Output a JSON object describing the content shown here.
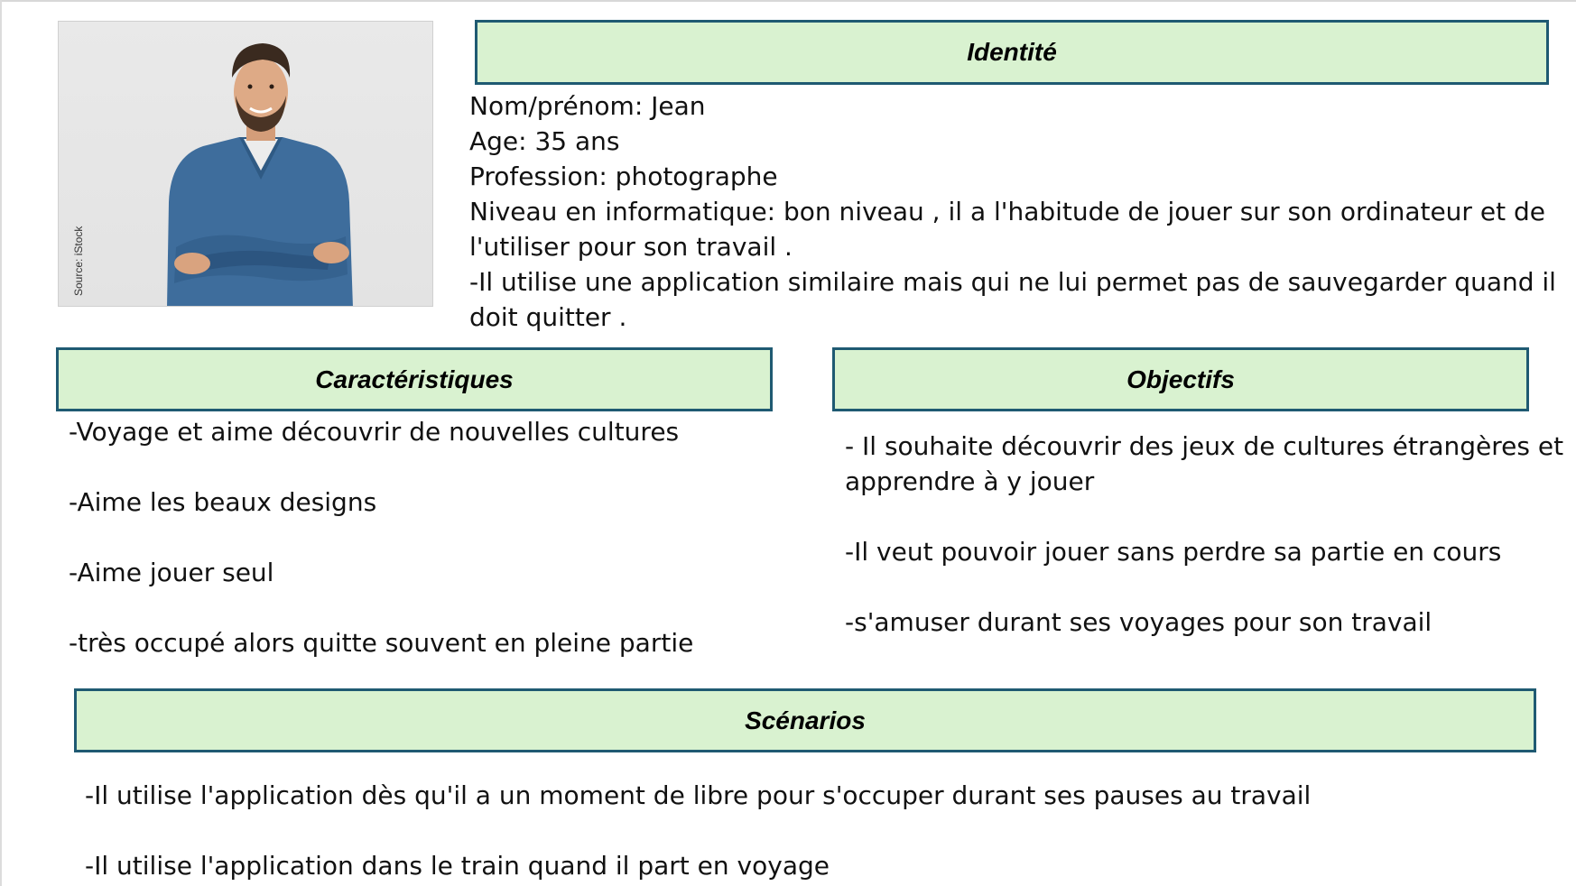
{
  "photo": {
    "credit": "Source: iStock",
    "icon": "portrait-photo"
  },
  "identite": {
    "title": "Identité",
    "lines": [
      "Nom/prénom: Jean",
      "Age: 35 ans",
      "Profession: photographe",
      "Niveau en informatique:  bon niveau , il a l'habitude de jouer sur son ordinateur et de",
      "l'utiliser pour son travail .",
      "-Il utilise une application similaire mais qui ne lui permet pas de sauvegarder quand il",
      "doit quitter ."
    ]
  },
  "caracteristiques": {
    "title": "Caractéristiques",
    "items": [
      "-Voyage et aime découvrir de nouvelles cultures",
      "-Aime les beaux designs",
      "-Aime jouer seul",
      "-très occupé alors quitte souvent en pleine partie"
    ]
  },
  "objectifs": {
    "title": "Objectifs",
    "items": [
      "- Il souhaite découvrir des jeux de cultures étrangères et",
      "apprendre à y jouer",
      "-Il veut pouvoir jouer sans perdre sa partie en cours",
      "-s'amuser durant ses voyages pour son travail"
    ]
  },
  "scenarios": {
    "title": "Scénarios",
    "items": [
      "-Il utilise l'application dès qu'il a un moment de libre pour s'occuper durant ses pauses au travail",
      "-Il utilise l'application dans le train quand il part en voyage"
    ]
  },
  "colors": {
    "header_fill": "#d9f2d0",
    "header_border": "#1f5a72"
  }
}
